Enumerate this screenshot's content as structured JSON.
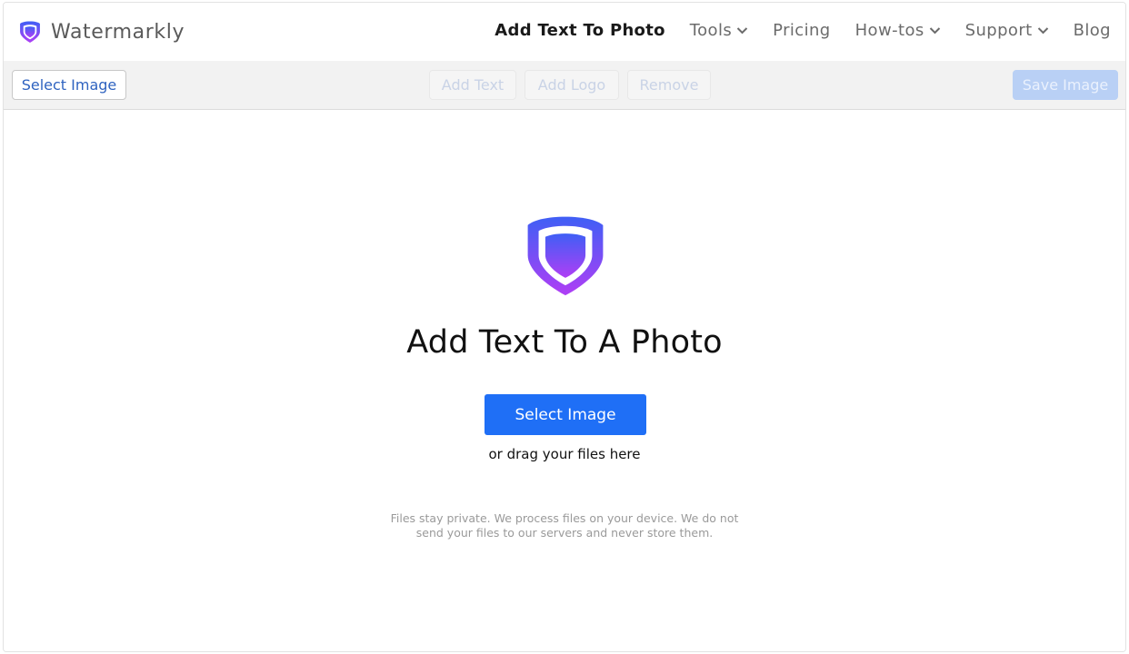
{
  "header": {
    "brand_name": "Watermarkly",
    "nav": [
      {
        "label": "Add Text To Photo",
        "active": true,
        "dropdown": false
      },
      {
        "label": "Tools",
        "active": false,
        "dropdown": true
      },
      {
        "label": "Pricing",
        "active": false,
        "dropdown": false
      },
      {
        "label": "How-tos",
        "active": false,
        "dropdown": true
      },
      {
        "label": "Support",
        "active": false,
        "dropdown": true
      },
      {
        "label": "Blog",
        "active": false,
        "dropdown": false
      }
    ]
  },
  "toolbar": {
    "select_image": "Select Image",
    "add_text": "Add Text",
    "add_logo": "Add Logo",
    "remove": "Remove",
    "save_image": "Save Image"
  },
  "main": {
    "title": "Add Text To A Photo",
    "cta_label": "Select Image",
    "drag_hint": "or drag your files here",
    "privacy_line1": "Files stay private. We process files on your device. We do not",
    "privacy_line2": "send your files to our servers and never store them."
  },
  "colors": {
    "primary": "#1f6ff6",
    "shield_top": "#3f5ff5",
    "shield_bottom": "#b03ef5"
  }
}
